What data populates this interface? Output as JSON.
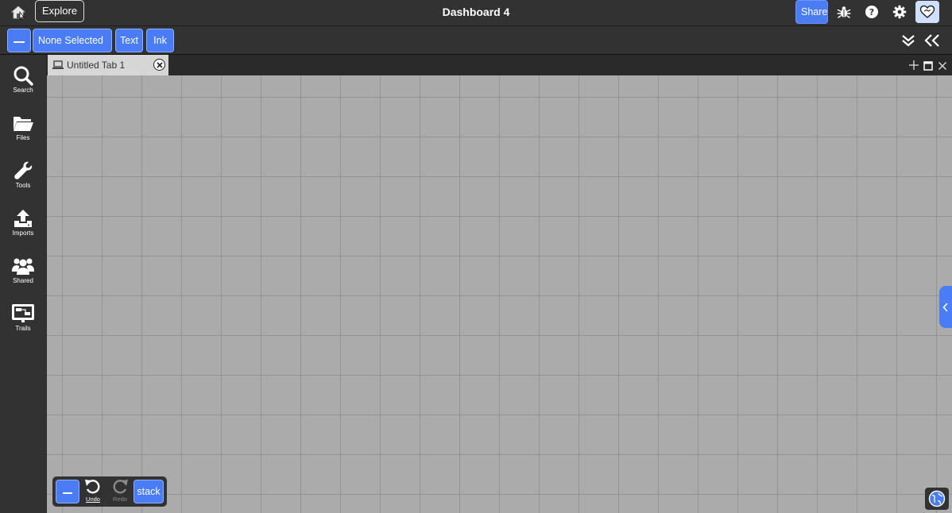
{
  "header": {
    "title": "Dashboard 4",
    "explore_label": "Explore",
    "share_label": "Share",
    "icons": [
      "home-icon",
      "bug-icon",
      "help-icon",
      "gear-icon",
      "heart-icon"
    ]
  },
  "toolbar": {
    "selection_label": "None Selected",
    "text_label": "Text",
    "ink_label": "Ink"
  },
  "sidebar": {
    "items": [
      {
        "label": "Search",
        "icon": "search-icon"
      },
      {
        "label": "Files",
        "icon": "folder-icon"
      },
      {
        "label": "Tools",
        "icon": "wrench-icon"
      },
      {
        "label": "Imports",
        "icon": "upload-icon"
      },
      {
        "label": "Shared",
        "icon": "users-icon"
      },
      {
        "label": "Trails",
        "icon": "trails-icon"
      }
    ]
  },
  "tabs": [
    {
      "label": "Untitled Tab 1",
      "icon": "laptop-icon"
    }
  ],
  "bottom_tools": {
    "undo_label": "Undo",
    "redo_label": "Redo",
    "stack_label": "stack"
  },
  "colors": {
    "accent": "#4a7cf6",
    "canvas": "#ababab",
    "chrome": "#323232"
  }
}
